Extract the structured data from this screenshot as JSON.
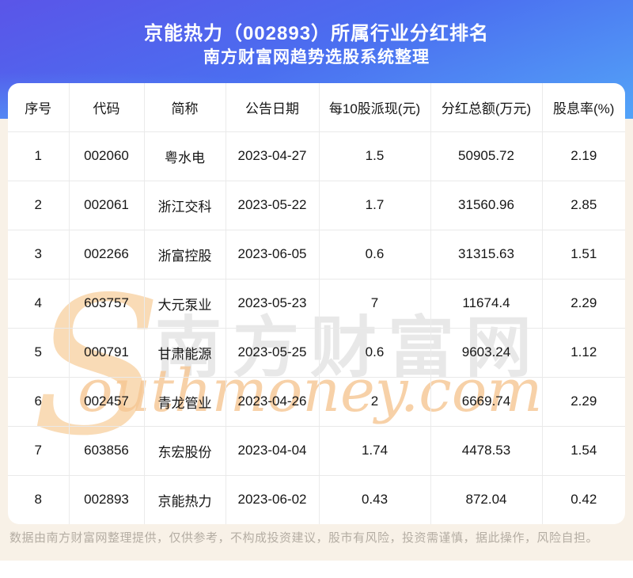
{
  "header": {
    "title": "京能热力（002893）所属行业分红排名",
    "subtitle": "南方财富网趋势选股系统整理"
  },
  "chart_data": {
    "type": "table",
    "title": "京能热力（002893）所属行业分红排名",
    "subtitle": "南方财富网趋势选股系统整理",
    "columns": [
      "序号",
      "代码",
      "简称",
      "公告日期",
      "每10股派现(元)",
      "分红总额(万元)",
      "股息率(%)"
    ],
    "rows": [
      [
        "1",
        "002060",
        "粤水电",
        "2023-04-27",
        "1.5",
        "50905.72",
        "2.19"
      ],
      [
        "2",
        "002061",
        "浙江交科",
        "2023-05-22",
        "1.7",
        "31560.96",
        "2.85"
      ],
      [
        "3",
        "002266",
        "浙富控股",
        "2023-06-05",
        "0.6",
        "31315.63",
        "1.51"
      ],
      [
        "4",
        "603757",
        "大元泵业",
        "2023-05-23",
        "7",
        "11674.4",
        "2.29"
      ],
      [
        "5",
        "000791",
        "甘肃能源",
        "2023-05-25",
        "0.6",
        "9603.24",
        "1.12"
      ],
      [
        "6",
        "002457",
        "青龙管业",
        "2023-04-26",
        "2",
        "6669.74",
        "2.29"
      ],
      [
        "7",
        "603856",
        "东宏股份",
        "2023-04-04",
        "1.74",
        "4478.53",
        "1.54"
      ],
      [
        "8",
        "002893",
        "京能热力",
        "2023-06-02",
        "0.43",
        "872.04",
        "0.42"
      ]
    ]
  },
  "watermark": {
    "s_glyph": "S",
    "cn_text": "南方财富网",
    "script_text": "outhmoney.com"
  },
  "footer": {
    "disclaimer": "数据由南方财富网整理提供，仅供参考，不构成投资建议，股市有风险，投资需谨慎，据此操作，风险自担。"
  },
  "colors": {
    "hero_gradient_top": "#5a55e8",
    "hero_gradient_mid": "#4b6ef0",
    "hero_gradient_bottom": "#53a4f7",
    "cream_background": "#f8f1e7",
    "card_background": "#ffffff",
    "table_border": "#ebebeb",
    "watermark_orange": "#f6c693",
    "watermark_gray": "#c9c9c9",
    "disclaimer_text": "#b4ada3"
  }
}
